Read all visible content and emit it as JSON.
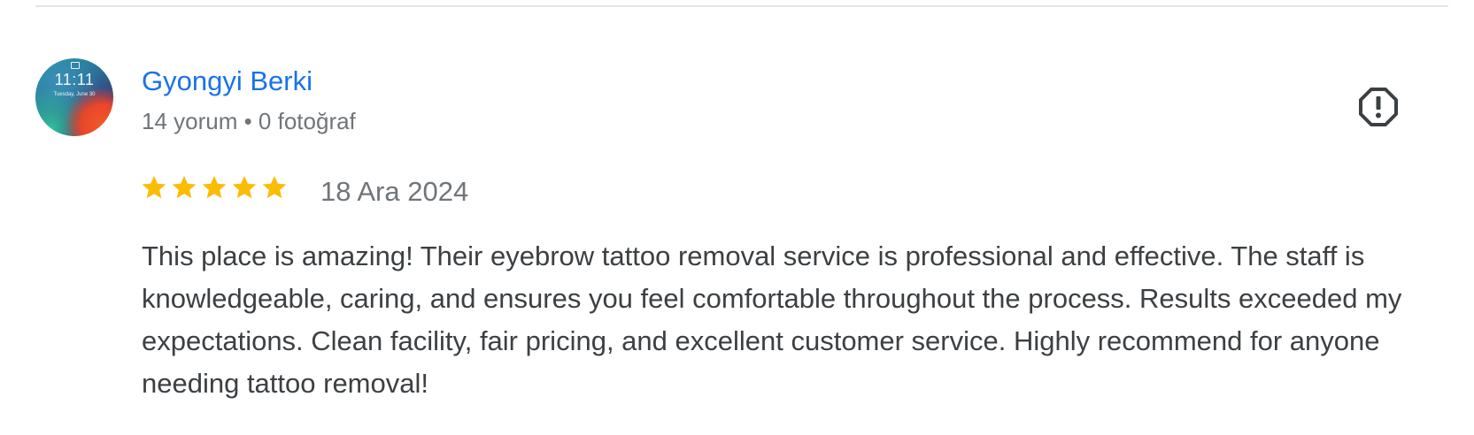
{
  "review": {
    "author_name": "Gyongyi Berki",
    "author_meta": "14 yorum • 0 fotoğraf",
    "avatar": {
      "time": "11:11",
      "date": "Tuesday, June 30"
    },
    "rating": 5,
    "rating_max": 5,
    "date": "18 Ara 2024",
    "text": "This place is amazing! Their eyebrow tattoo removal service is professional and effective. The staff is knowledgeable, caring, and ensures you feel comfortable throughout the process. Results exceeded my expectations. Clean facility, fair pricing, and excellent customer service. Highly recommend for anyone needing tattoo removal!"
  },
  "icons": {
    "report": "report-icon",
    "star": "star-icon"
  },
  "colors": {
    "link": "#1a73e8",
    "star": "#fbbc04",
    "meta": "#70757a",
    "text": "#3c4043",
    "report": "#3c4043"
  }
}
